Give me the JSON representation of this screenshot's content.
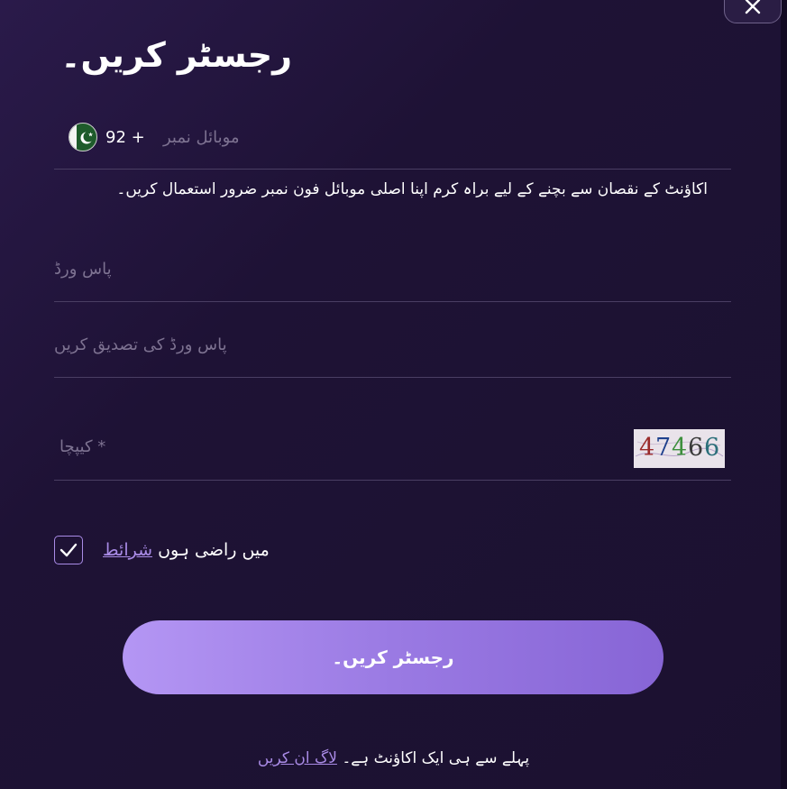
{
  "form": {
    "title": "رجسٹر کریں۔",
    "phone": {
      "country_flag": "pakistan-flag",
      "dial_code": "92 +",
      "placeholder": "موبائل نمبر"
    },
    "helper_text": "اکاؤنٹ کے نقصان سے بچنے کے لیے براہ کرم اپنا اصلی موبائل فون نمبر ضرور استعمال کریں۔",
    "password_placeholder": "پاس ورڈ",
    "confirm_password_placeholder": "پاس ورڈ کی تصدیق کریں",
    "captcha": {
      "placeholder": "* کیپچا",
      "code": "47466",
      "digits": [
        "4",
        "7",
        "4",
        "6",
        "6"
      ],
      "digit_colors": [
        "#9a2a2a",
        "#1d3f8c",
        "#3d8f3d",
        "#3b3b3b",
        "#2b6f7a"
      ]
    },
    "terms": {
      "checked": true,
      "prefix": "میں راضی ہوں",
      "link": "شرائط"
    },
    "submit_label": "رجسٹر کریں۔",
    "footer": {
      "question": "پہلے سے ہی ایک اکاؤنٹ ہے۔",
      "link": "لاگ ان کریں"
    }
  },
  "colors": {
    "background": "#1b1130",
    "accent": "#a98be6",
    "button_gradient_start": "#b496f4",
    "button_gradient_end": "#8765d6",
    "placeholder": "#7d7291",
    "divider": "#4a3e63"
  },
  "icons": {
    "close": "close-icon",
    "checkmark": "check-icon"
  }
}
